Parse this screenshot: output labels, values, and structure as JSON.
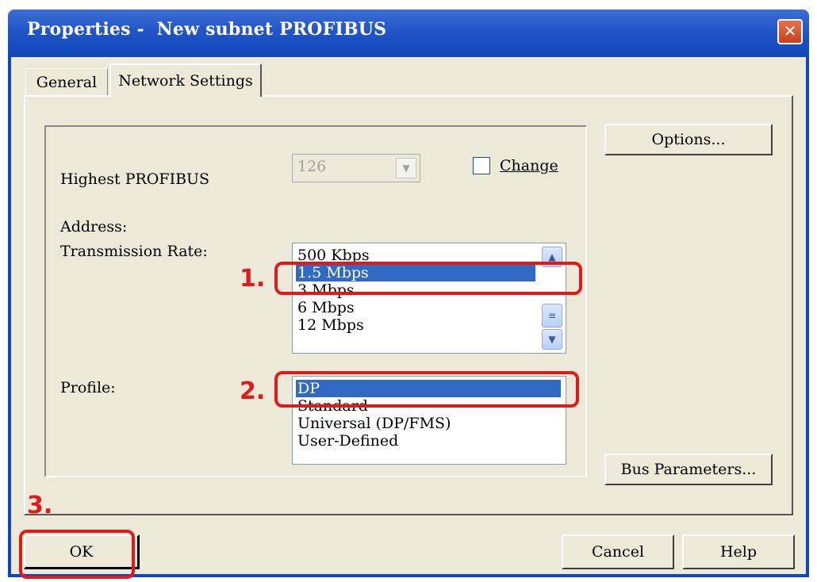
{
  "window": {
    "title": "Properties -  New subnet PROFIBUS",
    "close_label": "✕"
  },
  "tabs": [
    {
      "label": "General"
    },
    {
      "label": "Network Settings"
    }
  ],
  "highest_address": {
    "label_line1": "Highest PROFIBUS",
    "label_line2": "Address:",
    "value": "126",
    "change_label": "Change"
  },
  "transmission_rate": {
    "label": "Transmission Rate:",
    "items": [
      "500 Kbps",
      "1.5 Mbps",
      "3 Mbps",
      "6 Mbps",
      "12 Mbps"
    ],
    "selected": "1.5 Mbps"
  },
  "profile": {
    "label": "Profile:",
    "items": [
      "DP",
      "Standard",
      "Universal (DP/FMS)",
      "User-Defined"
    ],
    "selected": "DP"
  },
  "buttons": {
    "options": "Options...",
    "bus_parameters": "Bus Parameters...",
    "ok": "OK",
    "cancel": "Cancel",
    "help": "Help"
  },
  "annotations": {
    "step1": "1.",
    "step2": "2.",
    "step3": "3."
  },
  "colors": {
    "selection": "#316ac5",
    "annotation": "#e01a1a",
    "titlebar": "#2457c8",
    "dialog_bg": "#ece9d8"
  }
}
